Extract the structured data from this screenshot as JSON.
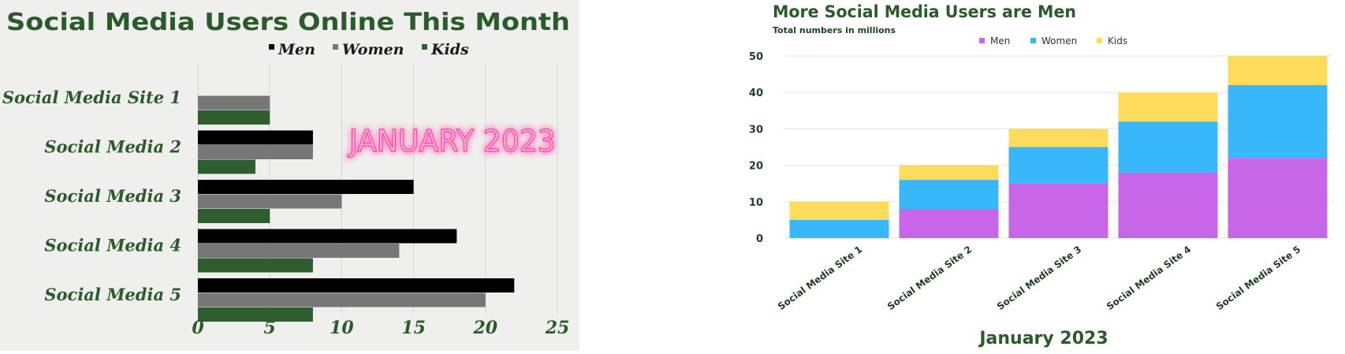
{
  "chart_data": [
    {
      "type": "bar",
      "orientation": "horizontal",
      "title": "Social Media Users Online This Month",
      "annotation": "JANUARY 2023",
      "categories": [
        "Social Media Site 1",
        "Social Media 2",
        "Social Media 3",
        "Social Media 4",
        "Social Media 5"
      ],
      "series": [
        {
          "name": "Men",
          "values": [
            0,
            8,
            15,
            18,
            22
          ],
          "color": "#000000"
        },
        {
          "name": "Women",
          "values": [
            5,
            8,
            10,
            14,
            20
          ],
          "color": "#777777"
        },
        {
          "name": "Kids",
          "values": [
            5,
            4,
            5,
            8,
            8
          ],
          "color": "#2e5d2e"
        }
      ],
      "xlim": [
        0,
        25
      ],
      "x_ticks": [
        "0",
        "5",
        "10",
        "15",
        "20",
        "25"
      ],
      "grid": true,
      "legend_position": "top-right",
      "title_color": "#2b5a2b",
      "annotation_color": "#ff5fb0",
      "background_color": "#efefed"
    },
    {
      "type": "bar",
      "stacked": true,
      "title": "More Social Media Users are Men",
      "subtitle": "Total numbers in millions",
      "xlabel": "January 2023",
      "categories": [
        "Social Media Site 1",
        "Social Media Site 2",
        "Social Media Site 3",
        "Social Media Site 4",
        "Social Media Site 5"
      ],
      "series": [
        {
          "name": "Men",
          "values": [
            0,
            8,
            15,
            18,
            22
          ],
          "color": "#c766e6"
        },
        {
          "name": "Women",
          "values": [
            5,
            8,
            10,
            14,
            20
          ],
          "color": "#38b7fb"
        },
        {
          "name": "Kids",
          "values": [
            5,
            4,
            5,
            8,
            8
          ],
          "color": "#fddc5c"
        }
      ],
      "ylim": [
        0,
        50
      ],
      "y_ticks": [
        "0",
        "10",
        "20",
        "30",
        "40",
        "50"
      ],
      "grid": true,
      "legend_position": "top",
      "title_color": "#2b5a2b"
    }
  ]
}
